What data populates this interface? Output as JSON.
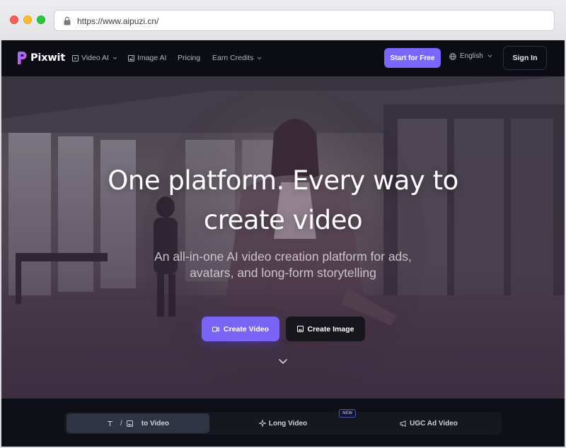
{
  "browser": {
    "url": "https://www.aipuzi.cn/"
  },
  "nav": {
    "logo_text": "Pixwit",
    "items": [
      {
        "label": "Video AI",
        "icon": "video-frame-icon",
        "has_dropdown": true
      },
      {
        "label": "Image AI",
        "icon": "image-icon",
        "has_dropdown": false
      },
      {
        "label": "Pricing",
        "icon": null,
        "has_dropdown": false
      },
      {
        "label": "Earn Credits",
        "icon": null,
        "has_dropdown": true
      }
    ],
    "start_button": "Start for Free",
    "language": "English",
    "sign_in": "Sign In"
  },
  "hero": {
    "headline_line1": "One platform. Every way to",
    "headline_line2": "create video",
    "subhead_line1": "An all-in-one AI video creation platform for ads,",
    "subhead_line2": "avatars, and long-form storytelling",
    "primary_button": "Create Video",
    "secondary_button": "Create Image"
  },
  "tabs": {
    "items": [
      {
        "label": "to Video",
        "active": true,
        "icons": [
          "text-icon",
          "image-icon"
        ],
        "separator": "/"
      },
      {
        "label": "Long Video",
        "active": false,
        "icons": [
          "sparkle-icon"
        ],
        "badge": "NEW"
      },
      {
        "label": "UGC Ad Video",
        "active": false,
        "icons": [
          "megaphone-icon"
        ]
      }
    ]
  },
  "colors": {
    "accent": "#7b67ff",
    "nav_bg": "#0c0c14",
    "tab_active": "#2e3444"
  }
}
